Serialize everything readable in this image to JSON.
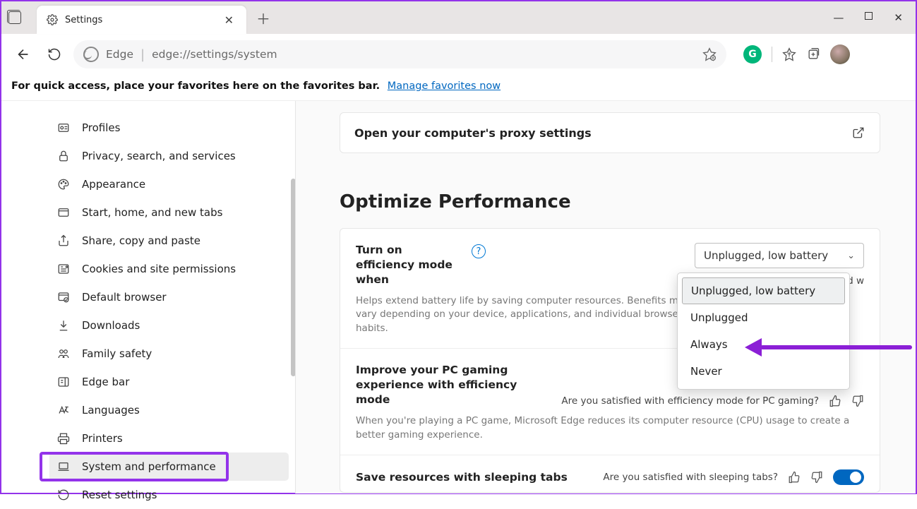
{
  "tab": {
    "title": "Settings"
  },
  "addressbar": {
    "brand": "Edge",
    "url": "edge://settings/system"
  },
  "favbar": {
    "text": "For quick access, place your favorites here on the favorites bar.",
    "link": "Manage favorites now"
  },
  "sidebar": {
    "items": [
      {
        "label": "Profiles"
      },
      {
        "label": "Privacy, search, and services"
      },
      {
        "label": "Appearance"
      },
      {
        "label": "Start, home, and new tabs"
      },
      {
        "label": "Share, copy and paste"
      },
      {
        "label": "Cookies and site permissions"
      },
      {
        "label": "Default browser"
      },
      {
        "label": "Downloads"
      },
      {
        "label": "Family safety"
      },
      {
        "label": "Edge bar"
      },
      {
        "label": "Languages"
      },
      {
        "label": "Printers"
      },
      {
        "label": "System and performance"
      },
      {
        "label": "Reset settings"
      }
    ],
    "active_index": 12
  },
  "main": {
    "proxy_link": "Open your computer's proxy settings",
    "section_title": "Optimize Performance",
    "efficiency": {
      "title": "Turn on efficiency mode when",
      "selected": "Unplugged, low battery",
      "satisfied_prefix": "Are you satisfied w",
      "desc": "Helps extend battery life by saving computer resources. Benefits may vary depending on your device, applications, and individual browser habits.",
      "options": [
        "Unplugged, low battery",
        "Unplugged",
        "Always",
        "Never"
      ]
    },
    "gaming": {
      "title": "Improve your PC gaming experience with efficiency mode",
      "satisfied": "Are you satisfied with efficiency mode for PC gaming?",
      "desc": "When you're playing a PC game, Microsoft Edge reduces its computer resource (CPU) usage to create a better gaming experience."
    },
    "sleeping": {
      "title": "Save resources with sleeping tabs",
      "satisfied": "Are you satisfied with sleeping tabs?"
    }
  }
}
